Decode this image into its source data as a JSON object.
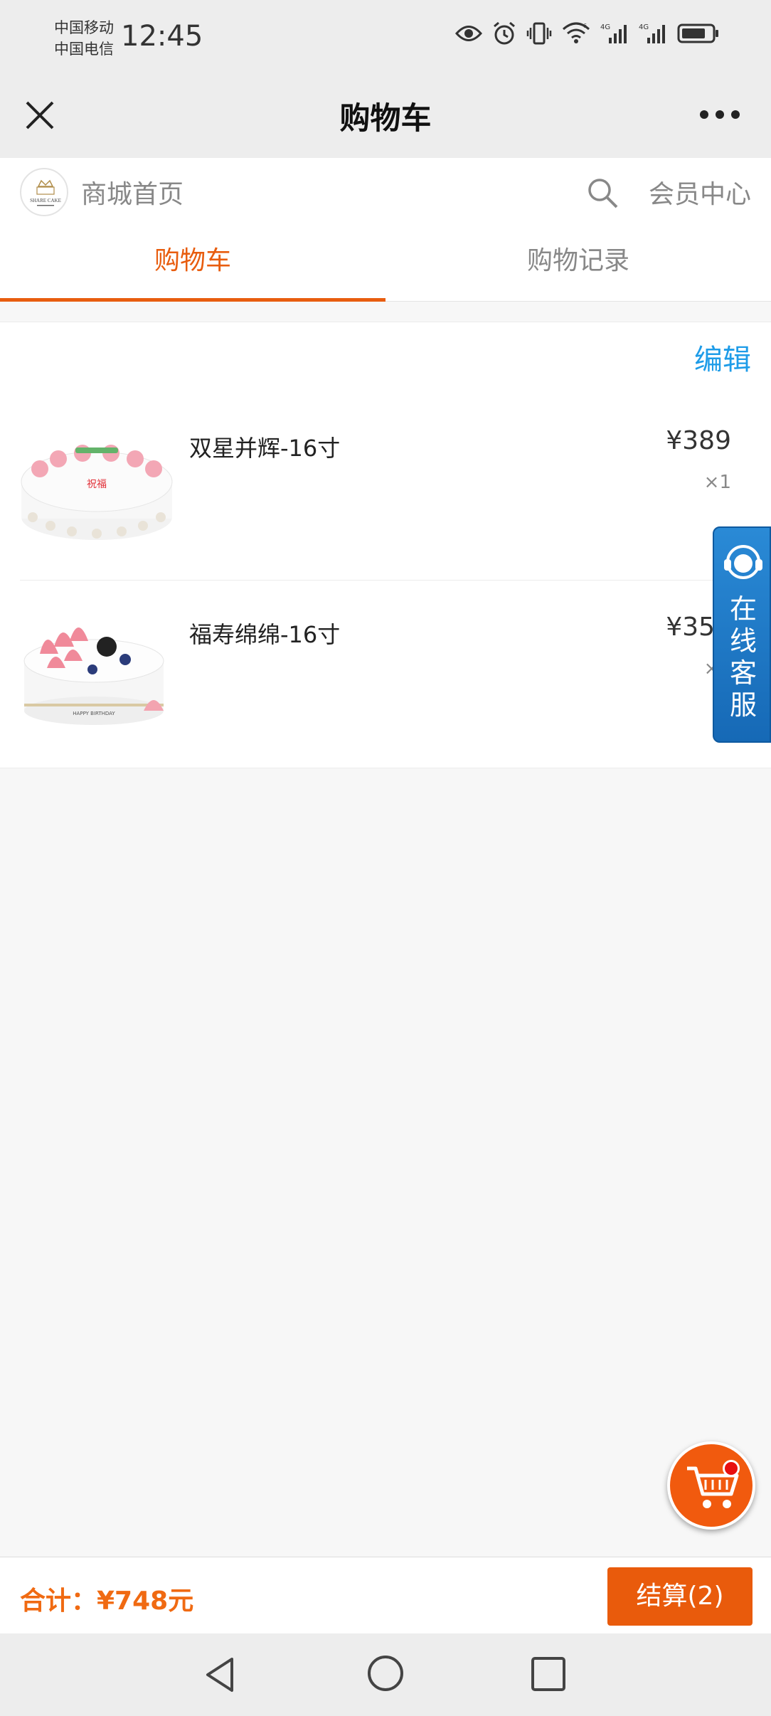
{
  "status_bar": {
    "carrier1": "中国移动",
    "carrier2": "中国电信",
    "time": "12:45",
    "icons": [
      "eye-icon",
      "alarm-icon",
      "vibrate-icon",
      "wifi-icon",
      "signal-4g-icon",
      "signal-4g-icon",
      "battery-icon"
    ]
  },
  "titlebar": {
    "title": "购物车",
    "close_icon": "close-icon",
    "more_icon": "more-icon"
  },
  "shop": {
    "home_label": "商城首页",
    "member_label": "会员中心",
    "logo_text": "SHARE CAKE"
  },
  "tabs": [
    {
      "label": "购物车",
      "active": true
    },
    {
      "label": "购物记录",
      "active": false
    }
  ],
  "cart": {
    "edit_label": "编辑",
    "items": [
      {
        "name": "双星并辉-16寸",
        "price": "¥389",
        "qty": "×1"
      },
      {
        "name": "福寿绵绵-16寸",
        "price": "¥359",
        "qty": "×1"
      }
    ]
  },
  "service": {
    "label": "在线客服"
  },
  "bottom": {
    "total": "合计：¥748元",
    "checkout": "结算(2)"
  },
  "colors": {
    "accent": "#e85d0f",
    "link": "#1e9ce8",
    "service": "#1d75c4"
  }
}
